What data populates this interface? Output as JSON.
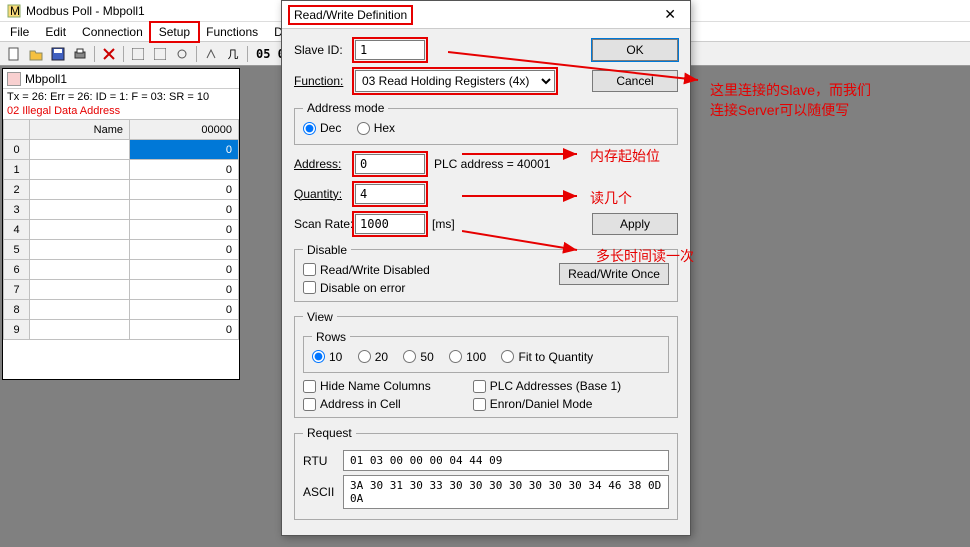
{
  "window": {
    "title": "Modbus Poll - Mbpoll1"
  },
  "menu": {
    "file": "File",
    "edit": "Edit",
    "connection": "Connection",
    "setup": "Setup",
    "functions": "Functions",
    "display": "Di"
  },
  "toolbar": {
    "counter": "05 0"
  },
  "child": {
    "title": "Mbpoll1",
    "status": "Tx = 26: Err = 26: ID = 1: F = 03: SR = 10",
    "error": "02 Illegal Data Address",
    "headers": {
      "idx": "",
      "name": "Name",
      "val": "00000"
    },
    "rows": [
      {
        "i": "0",
        "n": "",
        "v": "0"
      },
      {
        "i": "1",
        "n": "",
        "v": "0"
      },
      {
        "i": "2",
        "n": "",
        "v": "0"
      },
      {
        "i": "3",
        "n": "",
        "v": "0"
      },
      {
        "i": "4",
        "n": "",
        "v": "0"
      },
      {
        "i": "5",
        "n": "",
        "v": "0"
      },
      {
        "i": "6",
        "n": "",
        "v": "0"
      },
      {
        "i": "7",
        "n": "",
        "v": "0"
      },
      {
        "i": "8",
        "n": "",
        "v": "0"
      },
      {
        "i": "9",
        "n": "",
        "v": "0"
      }
    ]
  },
  "dialog": {
    "title": "Read/Write Definition",
    "slave_lbl": "Slave ID:",
    "slave_val": "1",
    "func_lbl": "Function:",
    "func_val": "03 Read Holding Registers (4x)",
    "addr_mode_lbl": "Address mode",
    "dec": "Dec",
    "hex": "Hex",
    "addr_lbl": "Address:",
    "addr_val": "0",
    "plc_addr": "PLC address = 40001",
    "qty_lbl": "Quantity:",
    "qty_val": "4",
    "scan_lbl": "Scan Rate:",
    "scan_val": "1000",
    "scan_unit": "[ms]",
    "ok": "OK",
    "cancel": "Cancel",
    "apply": "Apply",
    "disable_lbl": "Disable",
    "rw_disabled": "Read/Write Disabled",
    "dis_err": "Disable on error",
    "rw_once": "Read/Write Once",
    "view_lbl": "View",
    "rows_lbl": "Rows",
    "r10": "10",
    "r20": "20",
    "r50": "50",
    "r100": "100",
    "rfit": "Fit to Quantity",
    "hide_name": "Hide Name Columns",
    "plc_base": "PLC Addresses (Base 1)",
    "addr_cell": "Address in Cell",
    "enron": "Enron/Daniel Mode",
    "req_lbl": "Request",
    "rtu_lbl": "RTU",
    "ascii_lbl": "ASCII",
    "rtu_val": "01 03 00 00 00 04 44 09",
    "ascii_val": "3A 30 31 30 33 30 30 30 30 30 30 30 34 46 38 0D 0A"
  },
  "anno": {
    "a1a": "这里连接的Slave，而我们",
    "a1b": "连接Server可以随便写",
    "a2": "内存起始位",
    "a3": "读几个",
    "a4": "多长时间读一次"
  }
}
